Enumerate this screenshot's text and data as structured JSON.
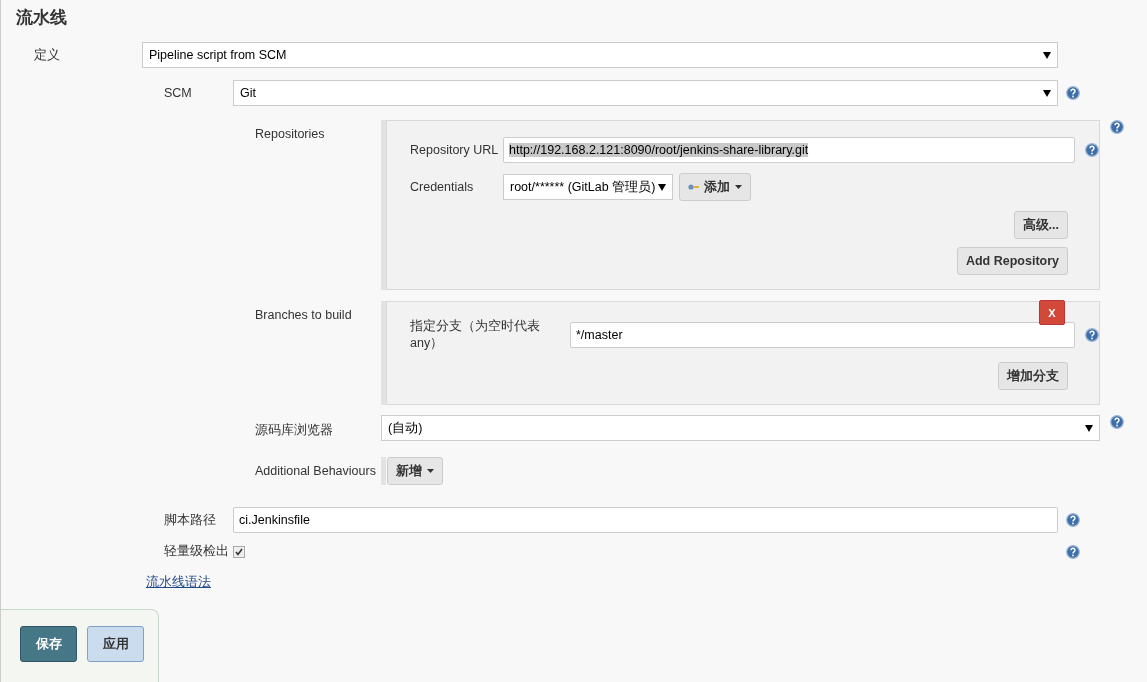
{
  "title": "流水线",
  "definition": {
    "label": "定义",
    "value": "Pipeline script from SCM"
  },
  "scm": {
    "label": "SCM",
    "value": "Git"
  },
  "repositories": {
    "label": "Repositories",
    "url_label": "Repository URL",
    "url": "http://192.168.2.121:8090/root/jenkins-share-library.git",
    "url_text_selected": true,
    "credentials_label": "Credentials",
    "credentials": "root/****** (GitLab 管理员)",
    "add_button": "添加",
    "advanced_button": "高级...",
    "add_repository_button": "Add Repository"
  },
  "branches": {
    "label": "Branches to build",
    "branch_label": "指定分支（为空时代表any）",
    "branch": "*/master",
    "delete_button": "X",
    "add_branch_button": "增加分支"
  },
  "browser": {
    "label": "源码库浏览器",
    "value": "(自动)"
  },
  "behaviours": {
    "label": "Additional Behaviours",
    "add_button": "新增"
  },
  "script_path": {
    "label": "脚本路径",
    "value": "ci.Jenkinsfile"
  },
  "lightweight": {
    "label": "轻量级检出",
    "checked": true
  },
  "syntax_link": "流水线语法",
  "buttons": [
    {
      "label": "保存",
      "kind": "primary"
    },
    {
      "label": "应用",
      "kind": "secondary"
    }
  ]
}
